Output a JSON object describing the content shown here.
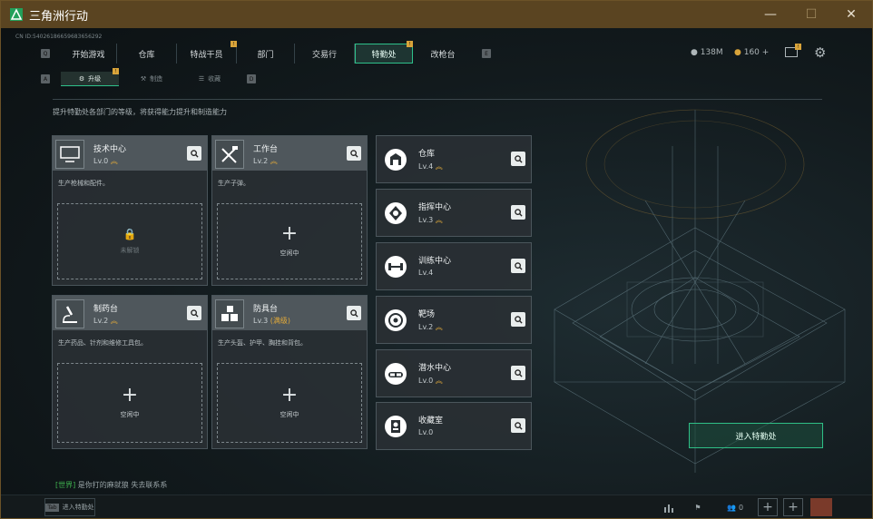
{
  "window": {
    "title": "三角洲行动",
    "minimize": "—",
    "maximize": "☐",
    "close": "✕"
  },
  "account_id": "CN ID:54026186659683656292",
  "topnav": {
    "keyhint_left": "Q",
    "keyhint_right": "E",
    "tabs": [
      {
        "label": "开始游戏"
      },
      {
        "label": "仓库"
      },
      {
        "label": "特战干员",
        "badge": "!"
      },
      {
        "label": "部门"
      },
      {
        "label": "交易行"
      },
      {
        "label": "特勤处",
        "badge": "!",
        "active": true
      },
      {
        "label": "改枪台"
      }
    ]
  },
  "currency": {
    "coins": "138M",
    "tickets": "160",
    "add": "+"
  },
  "subnav": {
    "keyhint_left": "A",
    "keyhint_right": "D",
    "tabs": [
      {
        "label": "升级",
        "active": true,
        "badge": "!"
      },
      {
        "label": "制造"
      },
      {
        "label": "收藏"
      }
    ]
  },
  "description": "提升特勤处各部门的等级，将获得能力提升和制造能力",
  "facilities": [
    {
      "name": "技术中心",
      "level": "Lv.0",
      "upgradable": true,
      "desc": "生产枪械和配件。",
      "slot": "未解锁",
      "locked": true
    },
    {
      "name": "工作台",
      "level": "Lv.2",
      "upgradable": true,
      "desc": "生产子弹。",
      "slot": "空闲中",
      "locked": false
    },
    {
      "name": "制药台",
      "level": "Lv.2",
      "upgradable": true,
      "desc": "生产药品、针剂和维修工具包。",
      "slot": "空闲中",
      "locked": false
    },
    {
      "name": "防具台",
      "level": "Lv.3",
      "max_tag": "(满级)",
      "upgradable": false,
      "desc": "生产头盔、护甲、胸挂和背包。",
      "slot": "空闲中",
      "locked": false
    }
  ],
  "side_facilities": [
    {
      "name": "仓库",
      "level": "Lv.4",
      "upgradable": true,
      "icon": "warehouse-icon"
    },
    {
      "name": "指挥中心",
      "level": "Lv.3",
      "upgradable": true,
      "icon": "command-icon"
    },
    {
      "name": "训练中心",
      "level": "Lv.4",
      "upgradable": false,
      "icon": "dumbbell-icon"
    },
    {
      "name": "靶场",
      "level": "Lv.2",
      "upgradable": true,
      "icon": "target-icon"
    },
    {
      "name": "潜水中心",
      "level": "Lv.0",
      "upgradable": true,
      "icon": "diving-icon"
    },
    {
      "name": "收藏室",
      "level": "Lv.0",
      "upgradable": false,
      "icon": "collection-icon"
    }
  ],
  "enter_button": "进入特勤处",
  "chat": {
    "channel": "[世界]",
    "message": "是你打的麻就狼  失去联系系"
  },
  "bottombar": {
    "shortcut_key": "Tab",
    "shortcut_label": "进入特勤处",
    "friends_count": "0"
  },
  "colors": {
    "accent": "#2ec08a",
    "badge": "#d9a43a",
    "title_bar": "#5a4421"
  }
}
